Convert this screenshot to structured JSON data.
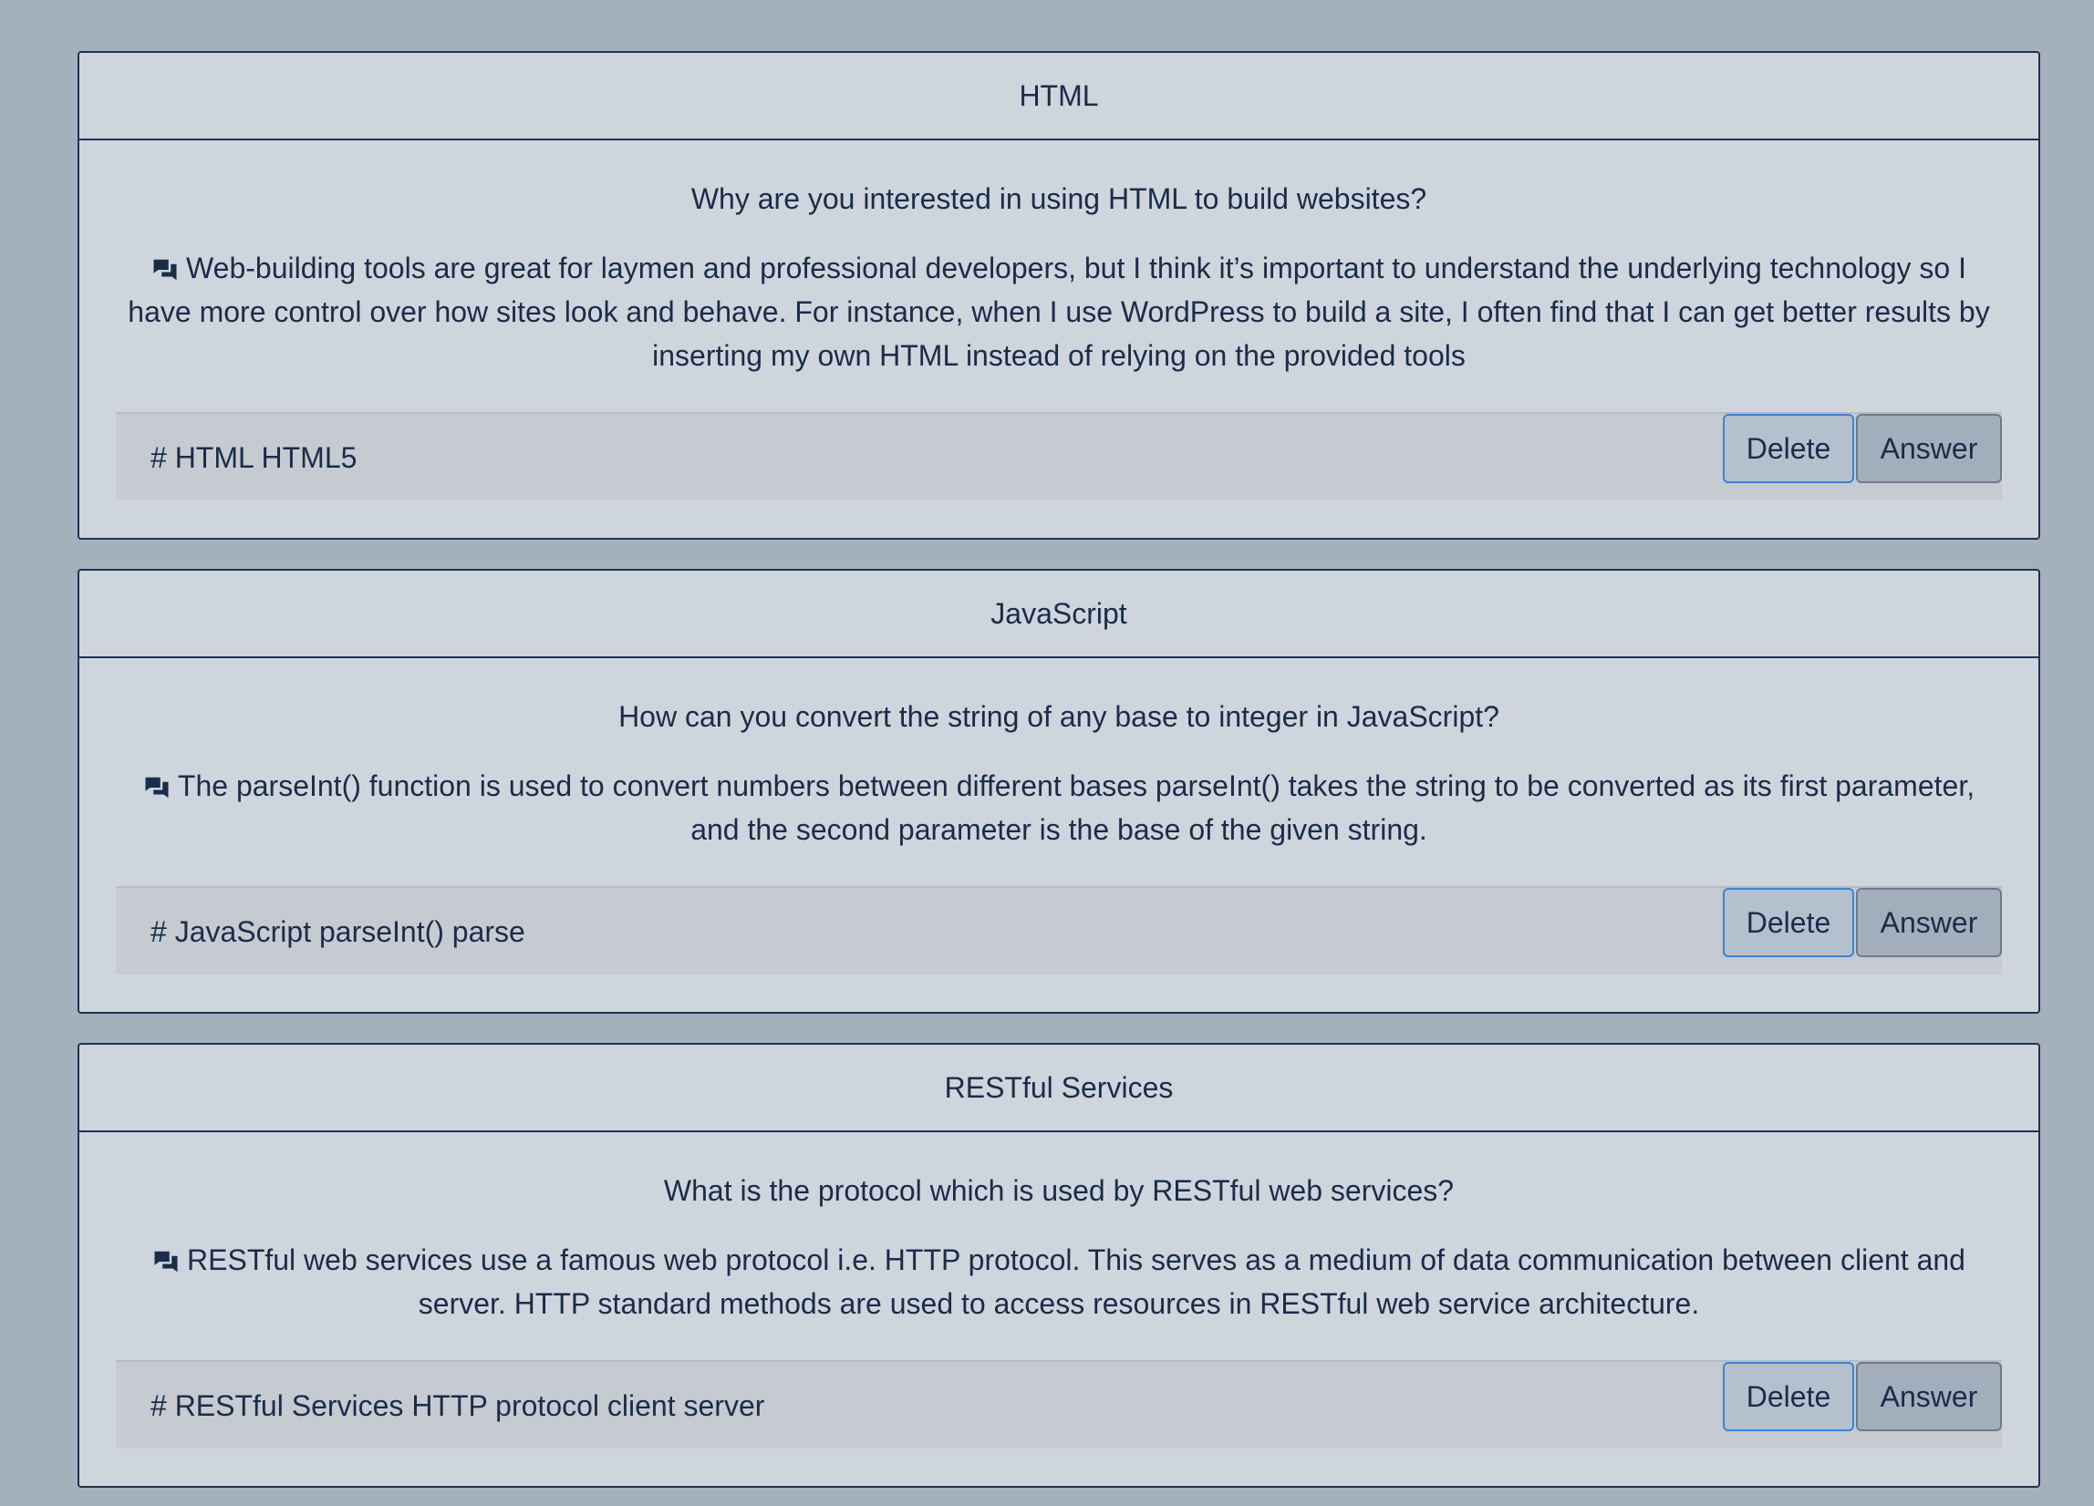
{
  "cards": [
    {
      "topic": "HTML",
      "question": "Why are you interested in using HTML to build websites?",
      "answer": "Web-building tools are great for laymen and professional developers, but I think it’s important to understand the underlying technology so I have more control over how sites look and behave. For instance, when I use WordPress to build a site, I often find that I can get better results by inserting my own HTML instead of relying on the provided tools",
      "tags": "# HTML HTML5",
      "delete_label": "Delete",
      "answer_label": "Answer"
    },
    {
      "topic": "JavaScript",
      "question": "How can you convert the string of any base to integer in JavaScript?",
      "answer": "The parseInt() function is used to convert numbers between different bases parseInt() takes the string to be converted as its first parameter, and the second parameter is the base of the given string.",
      "tags": "# JavaScript parseInt() parse",
      "delete_label": "Delete",
      "answer_label": "Answer"
    },
    {
      "topic": "RESTful Services",
      "question": "What is the protocol which is used by RESTful web services?",
      "answer": "RESTful web services use a famous web protocol i.e. HTTP protocol. This serves as a medium of data communication between client and server. HTTP standard methods are used to access resources in RESTful web service architecture.",
      "tags": "# RESTful Services HTTP protocol client server",
      "delete_label": "Delete",
      "answer_label": "Answer"
    }
  ],
  "icons": {
    "answer_icon": "chat-bubbles-icon"
  },
  "colors": {
    "background": "#a5b0bd",
    "card": "#ced5dc",
    "border": "#1f3253",
    "text": "#1b2c4a",
    "delete_border": "#3b82d6",
    "answer_button": "#a2aebb"
  }
}
